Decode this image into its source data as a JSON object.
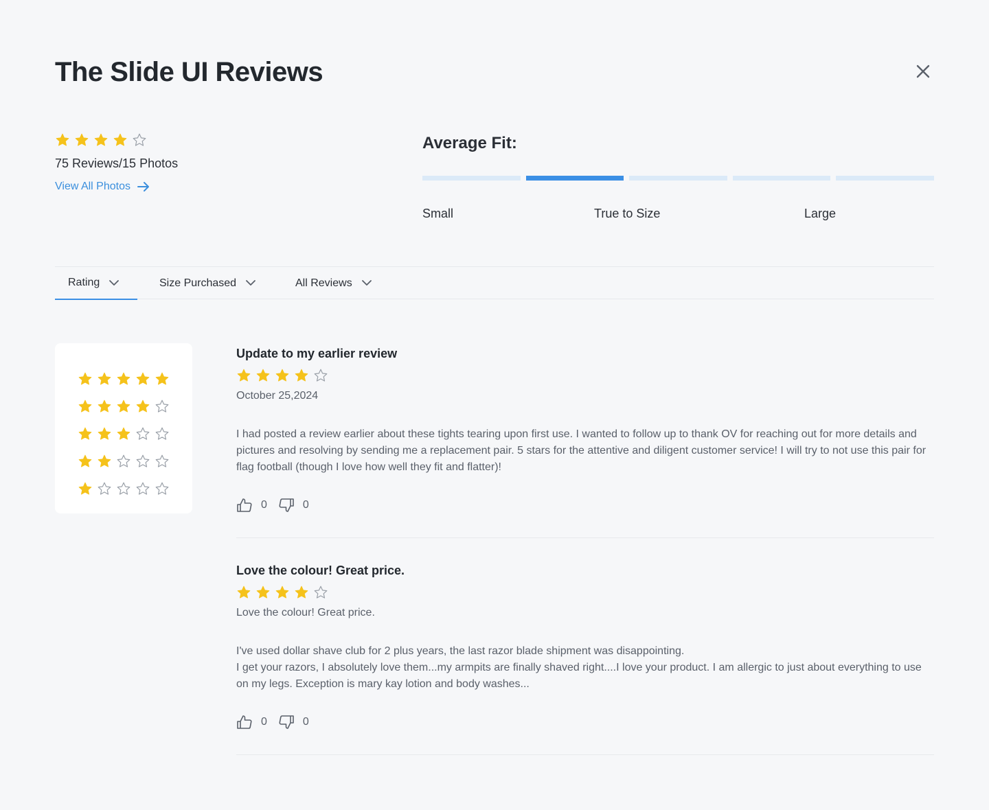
{
  "header": {
    "title": "The Slide UI Reviews",
    "close_icon": "close-icon"
  },
  "summary": {
    "rating": 4,
    "max_rating": 5,
    "count_text": "75 Reviews/15 Photos",
    "view_photos_label": "View All Photos"
  },
  "fit": {
    "title": "Average Fit:",
    "segments": 5,
    "active_segment": 2,
    "labels": {
      "small": "Small",
      "true_to_size": "True to Size",
      "large": "Large"
    }
  },
  "filters": {
    "tabs": [
      {
        "label": "Rating",
        "active": true
      },
      {
        "label": "Size Purchased",
        "active": false
      },
      {
        "label": "All Reviews",
        "active": false
      }
    ]
  },
  "rating_filter": {
    "options": [
      5,
      4,
      3,
      2,
      1
    ]
  },
  "reviews": [
    {
      "title": "Update to my earlier review",
      "rating": 4,
      "subtitle": "October 25,2024",
      "body": [
        "I had posted a review earlier about these tights tearing upon first use. I wanted to follow up to thank OV for reaching out for more details and pictures and resolving by sending me a replacement pair. 5 stars for the attentive and diligent customer service! I will try to not use this pair for flag football (though I love how well they fit and flatter)!"
      ],
      "likes": "0",
      "dislikes": "0"
    },
    {
      "title": "Love the colour! Great price.",
      "rating": 4,
      "subtitle": "Love the colour! Great price.",
      "body": [
        "I've used dollar shave club for 2 plus years, the last razor blade shipment was disappointing.",
        "I get your razors, I absolutely love them...my armpits are finally shaved right....I love your product. I am allergic to just about everything to use on my legs. Exception is mary kay lotion and body washes..."
      ],
      "likes": "0",
      "dislikes": "0"
    }
  ],
  "colors": {
    "star_filled": "#f5c21b",
    "star_empty": "#9aa0a8",
    "accent": "#3b8fe5",
    "link": "#3b8fdd"
  }
}
